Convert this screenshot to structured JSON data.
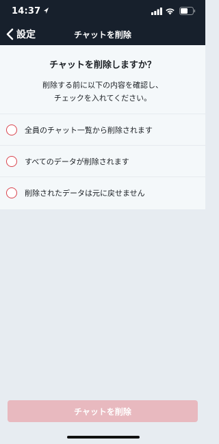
{
  "status_bar": {
    "time": "14:37",
    "icons": [
      "location-arrow-icon",
      "signal-icon",
      "wifi-icon",
      "battery-icon"
    ]
  },
  "nav": {
    "back_label": "設定",
    "title": "チャットを削除"
  },
  "confirm": {
    "title": "チャットを削除しますか？",
    "description_line1": "削除する前に以下の内容を確認し、",
    "description_line2": "チェックを入れてください。",
    "items": [
      {
        "label": "全員のチャット一覧から削除されます",
        "checked": false
      },
      {
        "label": "すべてのデータが削除されます",
        "checked": false
      },
      {
        "label": "削除されたデータは元に戻せません",
        "checked": false
      }
    ]
  },
  "delete_button": {
    "label": "チャットを削除",
    "enabled": false
  },
  "colors": {
    "header_bg": "#17202c",
    "panel_bg": "#f4f8fa",
    "page_bg": "#e7ecf1",
    "radio_border": "#d9434d",
    "button_disabled": "#e8b9bf"
  }
}
